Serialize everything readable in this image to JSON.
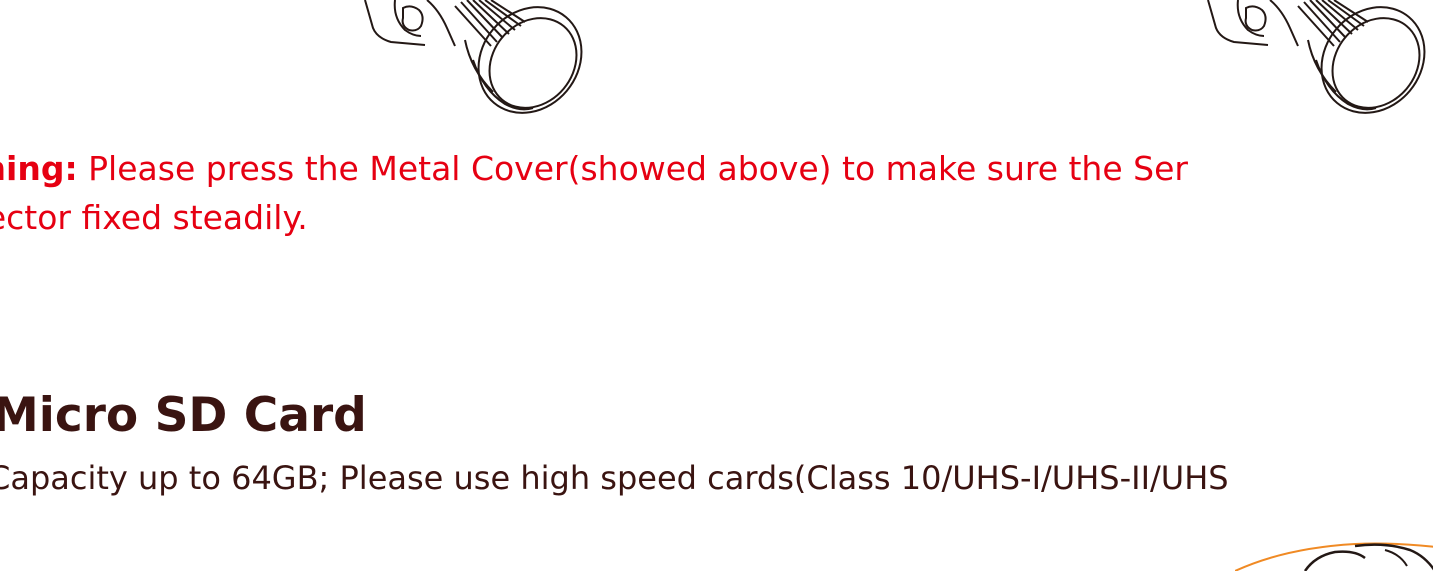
{
  "warning": {
    "lead": "arning:",
    "line1_text": " Please press the Metal Cover(showed above) to make sure the Ser",
    "line2_text": "nnector fixed steadily."
  },
  "section": {
    "title": "Micro SD Card",
    "text": "Capacity up to 64GB; Please use high speed cards(Class 10/UHS-I/UHS-II/UHS"
  },
  "colors": {
    "warning_red": "#e60012",
    "body_text": "#3a1411",
    "accent_orange": "#f08a24"
  },
  "icons": {
    "left": "camera-lens-icon",
    "right": "camera-lens-icon",
    "bottom": "sd-card-slot-icon"
  }
}
